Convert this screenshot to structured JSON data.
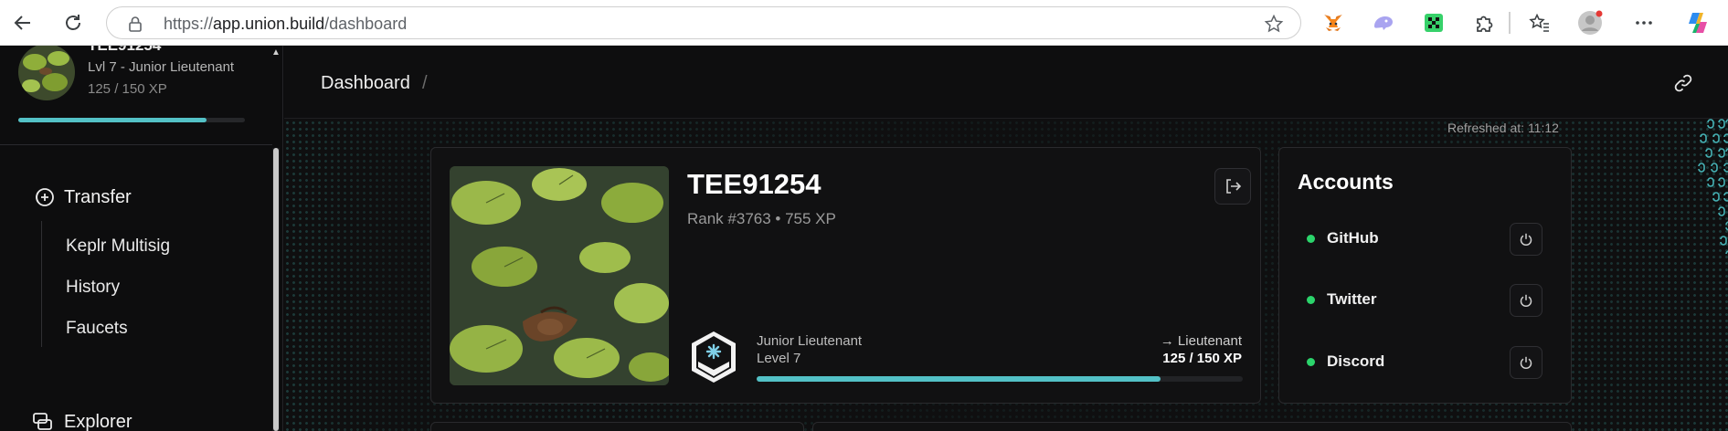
{
  "browser": {
    "url_prefix": "https://",
    "url_host": "app.union.build",
    "url_path": "/dashboard",
    "icons": [
      "back-icon",
      "reload-icon",
      "lock-icon",
      "star-icon",
      "metamask-icon",
      "keplr-icon",
      "extension-green-icon",
      "puzzle-icon",
      "favorites-icon",
      "profile-icon",
      "more-icon",
      "copilot-icon"
    ]
  },
  "sidebar": {
    "user_name": "TEE91254",
    "level_text": "Lvl 7 - Junior Lieutenant",
    "xp_text": "125 / 150 XP",
    "xp_progress": 0.83,
    "nav": {
      "transfer": "Transfer",
      "sub_items": [
        "Keplr Multisig",
        "History",
        "Faucets"
      ],
      "explorer": "Explorer"
    }
  },
  "header": {
    "breadcrumb": "Dashboard",
    "separator": "/"
  },
  "refreshed": "Refreshed at: 11:12",
  "profile": {
    "name": "TEE91254",
    "rank_line": "Rank #3763 • 755 XP",
    "rank_name": "Junior Lieutenant",
    "rank_level": "Level 7",
    "next_rank": "→ Lieutenant",
    "xp": "125 / 150 XP",
    "xp_progress": 0.83
  },
  "accounts": {
    "title": "Accounts",
    "items": [
      {
        "label": "GitHub",
        "status_color": "#2bd46b"
      },
      {
        "label": "Twitter",
        "status_color": "#2bd46b"
      },
      {
        "label": "Discord",
        "status_color": "#2bd46b"
      }
    ]
  },
  "colors": {
    "accent": "#53c1c6",
    "status_green": "#2bd46b",
    "background": "#0f0f10"
  }
}
